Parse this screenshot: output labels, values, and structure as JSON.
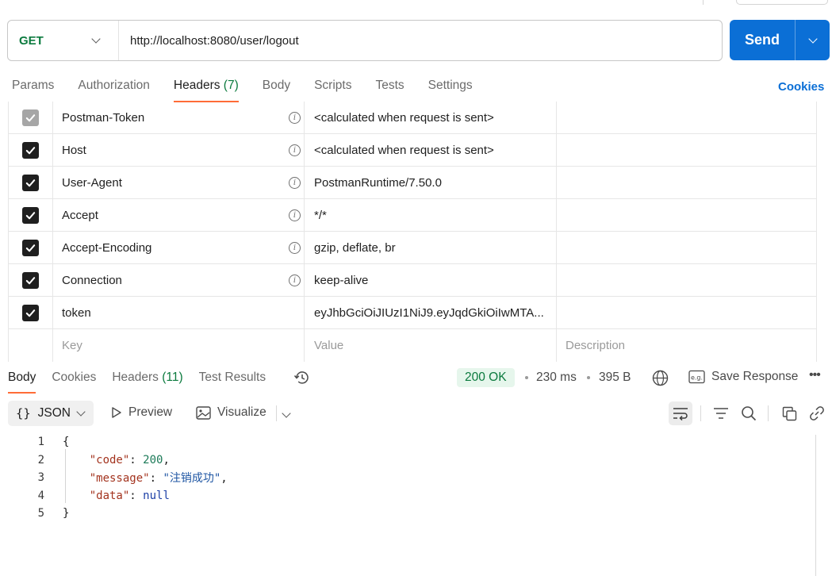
{
  "request": {
    "method": "GET",
    "url": "http://localhost:8080/user/logout",
    "send_label": "Send"
  },
  "request_tabs": [
    {
      "label": "Params"
    },
    {
      "label": "Authorization"
    },
    {
      "label": "Headers",
      "count": "(7)"
    },
    {
      "label": "Body"
    },
    {
      "label": "Scripts"
    },
    {
      "label": "Tests"
    },
    {
      "label": "Settings"
    }
  ],
  "cookies_label": "Cookies",
  "headers": [
    {
      "key": "Postman-Token",
      "value": "<calculated when request is sent>",
      "checked": true,
      "disabled": true
    },
    {
      "key": "Host",
      "value": "<calculated when request is sent>",
      "checked": true
    },
    {
      "key": "User-Agent",
      "value": "PostmanRuntime/7.50.0",
      "checked": true
    },
    {
      "key": "Accept",
      "value": "*/*",
      "checked": true
    },
    {
      "key": "Accept-Encoding",
      "value": "gzip, deflate, br",
      "checked": true
    },
    {
      "key": "Connection",
      "value": "keep-alive",
      "checked": true
    },
    {
      "key": "token",
      "value": "eyJhbGciOiJIUzI1NiJ9.eyJqdGkiOiIwMTA...",
      "checked": true
    }
  ],
  "headers_placeholder": {
    "key": "Key",
    "value": "Value",
    "description": "Description"
  },
  "response_tabs": [
    {
      "label": "Body"
    },
    {
      "label": "Cookies"
    },
    {
      "label": "Headers",
      "count": "(11)"
    },
    {
      "label": "Test Results"
    }
  ],
  "response_meta": {
    "status": "200 OK",
    "time": "230 ms",
    "size": "395 B",
    "save_label": "Save Response"
  },
  "viewer": {
    "format": "JSON",
    "preview_label": "Preview",
    "visualize_label": "Visualize"
  },
  "response_body": {
    "line_numbers": [
      "1",
      "2",
      "3",
      "4",
      "5"
    ],
    "open_brace": "{",
    "close_brace": "}",
    "code_key": "\"code\"",
    "code_value": "200",
    "message_key": "\"message\"",
    "message_value": "\"注销成功\"",
    "data_key": "\"data\"",
    "data_value": "null"
  },
  "colors": {
    "accent": "#0b6fd6",
    "active_tab_underline": "#ff6c37",
    "method_get": "#0b7a3e",
    "status_ok_bg": "#e6f6ec"
  }
}
